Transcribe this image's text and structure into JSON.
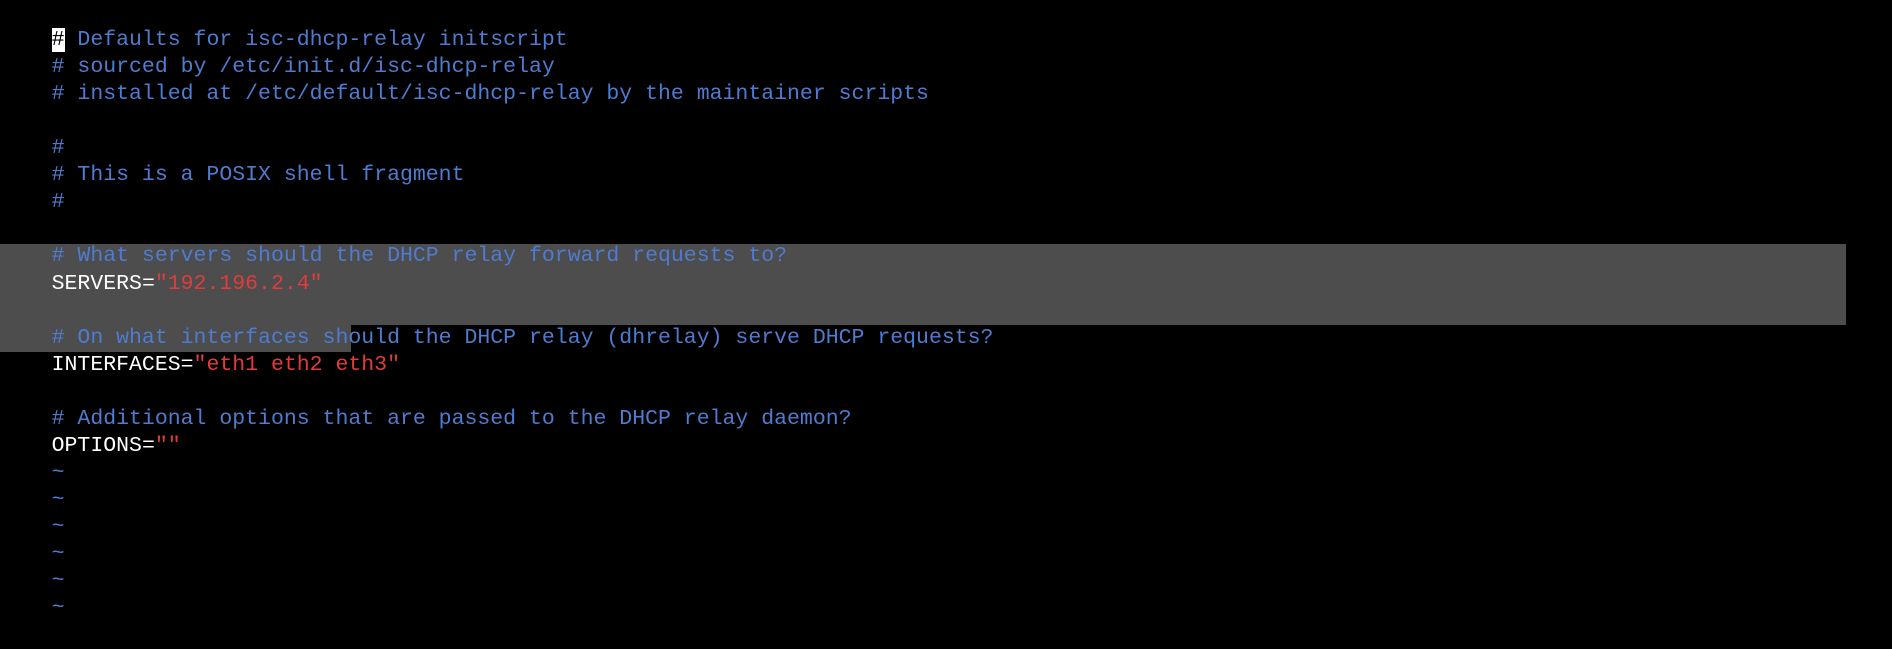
{
  "editor": {
    "colors": {
      "background": "#000000",
      "comment": "#4f7bd0",
      "string": "#e03c3c",
      "text": "#ffffff",
      "selection": "#4d4d4d",
      "tilde": "#4f7bd0"
    },
    "lines": {
      "l1_cursor": "#",
      "l1_rest": " Defaults for isc-dhcp-relay initscript",
      "l2": "# sourced by /etc/init.d/isc-dhcp-relay",
      "l3": "# installed at /etc/default/isc-dhcp-relay by the maintainer scripts",
      "l5": "#",
      "l6": "# This is a POSIX shell fragment",
      "l7": "#",
      "l9": "# What servers should the DHCP relay forward requests to?",
      "l10_var": "SERVERS",
      "l10_eq": "=",
      "l10_val": "\"192.196.2.4\"",
      "l12": "# On what interfaces should the DHCP relay (dhrelay) serve DHCP requests?",
      "l13_var": "INTERFACES",
      "l13_eq": "=",
      "l13_val": "\"eth1 eth2 eth3\"",
      "l15": "# Additional options that are passed to the DHCP relay daemon?",
      "l16_var": "OPTIONS",
      "l16_eq": "=",
      "l16_val": "\"\""
    },
    "tilde": "~"
  }
}
